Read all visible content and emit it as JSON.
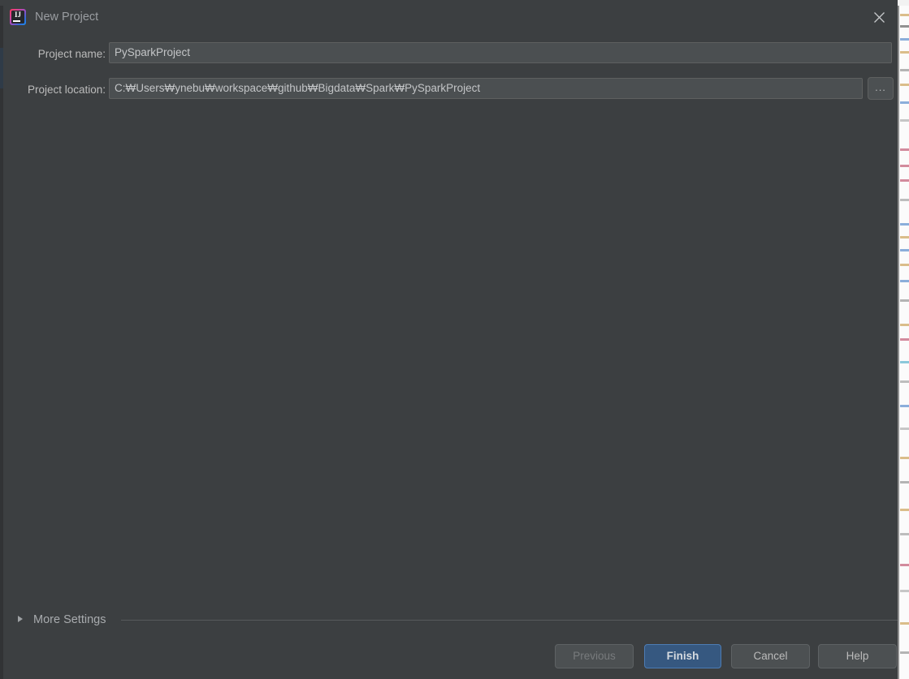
{
  "dialog": {
    "title": "New Project",
    "icon": "intellij-idea-icon",
    "close_icon": "close-icon"
  },
  "form": {
    "project_name": {
      "label": "Project name:",
      "value": "PySparkProject",
      "placeholder": ""
    },
    "project_location": {
      "label": "Project location:",
      "value": "C:₩Users₩ynebu₩workspace₩github₩Bigdata₩Spark₩PySparkProject",
      "placeholder": "",
      "browse_label": "...",
      "browse_icon": "ellipsis-icon"
    }
  },
  "more_settings": {
    "label": "More Settings",
    "expanded": false,
    "arrow_icon": "chevron-right-icon"
  },
  "buttons": {
    "previous": "Previous",
    "finish": "Finish",
    "cancel": "Cancel",
    "help": "Help"
  },
  "colors": {
    "dialog_background": "#3c3f41",
    "field_background": "#4b4f51",
    "text": "#bbbbbb",
    "default_button": "#365880",
    "default_button_border": "#4c7cb5",
    "title_text": "#9a9da1"
  }
}
